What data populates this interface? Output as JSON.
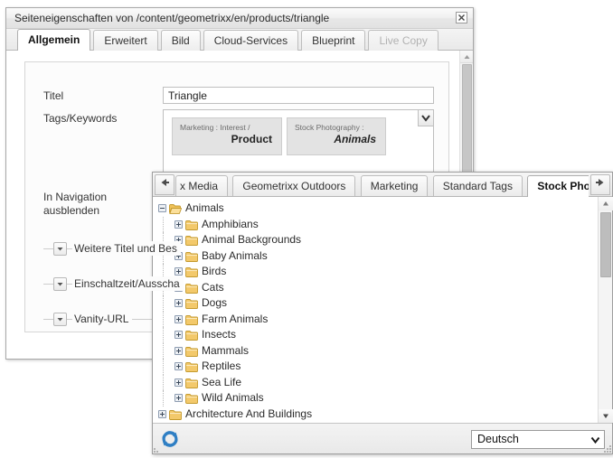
{
  "dialog": {
    "title": "Seiteneigenschaften von /content/geometrixx/en/products/triangle",
    "close_label": "close-icon",
    "tabs": [
      {
        "label": "Allgemein",
        "state": "active"
      },
      {
        "label": "Erweitert",
        "state": "normal"
      },
      {
        "label": "Bild",
        "state": "normal"
      },
      {
        "label": "Cloud-Services",
        "state": "normal"
      },
      {
        "label": "Blueprint",
        "state": "normal"
      },
      {
        "label": "Live Copy",
        "state": "disabled"
      }
    ],
    "form": {
      "title_label": "Titel",
      "title_value": "Triangle",
      "title_placeholder": "",
      "tags_label": "Tags/Keywords",
      "tags": [
        {
          "category": "Marketing : Interest /",
          "value": "Product",
          "italic": false
        },
        {
          "category": "Stock Photography :",
          "value": "Animals",
          "italic": true
        }
      ],
      "hide_nav_label_line1": "In Navigation",
      "hide_nav_label_line2": "ausblenden",
      "collapsibles": [
        {
          "label": "Weitere Titel und Bes",
          "toggle": "chevron-down-icon"
        },
        {
          "label": "Einschaltzeit/Ausscha",
          "toggle": "chevron-down-icon"
        },
        {
          "label": "Vanity-URL",
          "toggle": "chevron-down-icon"
        }
      ]
    }
  },
  "picker": {
    "nav_prev_icon": "arrow-left-icon",
    "nav_next_icon": "arrow-right-icon",
    "tabs": [
      {
        "label": "x Media",
        "active": false,
        "clipped": true
      },
      {
        "label": "Geometrixx Outdoors",
        "active": false,
        "clipped": false
      },
      {
        "label": "Marketing",
        "active": false,
        "clipped": false
      },
      {
        "label": "Standard Tags",
        "active": false,
        "clipped": false
      },
      {
        "label": "Stock Photography",
        "active": true,
        "clipped": false
      }
    ],
    "tree": [
      {
        "label": "Animals",
        "depth": 0,
        "expanded": true,
        "folder": "open"
      },
      {
        "label": "Amphibians",
        "depth": 1,
        "expanded": false,
        "folder": "closed"
      },
      {
        "label": "Animal Backgrounds",
        "depth": 1,
        "expanded": false,
        "folder": "closed"
      },
      {
        "label": "Baby Animals",
        "depth": 1,
        "expanded": false,
        "folder": "closed"
      },
      {
        "label": "Birds",
        "depth": 1,
        "expanded": false,
        "folder": "closed"
      },
      {
        "label": "Cats",
        "depth": 1,
        "expanded": false,
        "folder": "closed"
      },
      {
        "label": "Dogs",
        "depth": 1,
        "expanded": false,
        "folder": "closed"
      },
      {
        "label": "Farm Animals",
        "depth": 1,
        "expanded": false,
        "folder": "closed"
      },
      {
        "label": "Insects",
        "depth": 1,
        "expanded": false,
        "folder": "closed"
      },
      {
        "label": "Mammals",
        "depth": 1,
        "expanded": false,
        "folder": "closed"
      },
      {
        "label": "Reptiles",
        "depth": 1,
        "expanded": false,
        "folder": "closed"
      },
      {
        "label": "Sea Life",
        "depth": 1,
        "expanded": false,
        "folder": "closed"
      },
      {
        "label": "Wild Animals",
        "depth": 1,
        "expanded": false,
        "folder": "closed"
      },
      {
        "label": "Architecture And Buildings",
        "depth": 0,
        "expanded": false,
        "folder": "closed"
      }
    ],
    "footer": {
      "refresh_icon": "refresh-icon",
      "language_value": "Deutsch",
      "language_arrow": "chevron-down-icon"
    }
  },
  "colors": {
    "folder_closed": "#f3c96b",
    "folder_open": "#f0c259",
    "accent_blue": "#2a6fb5",
    "dialog_bg": "#f2f2f2"
  }
}
